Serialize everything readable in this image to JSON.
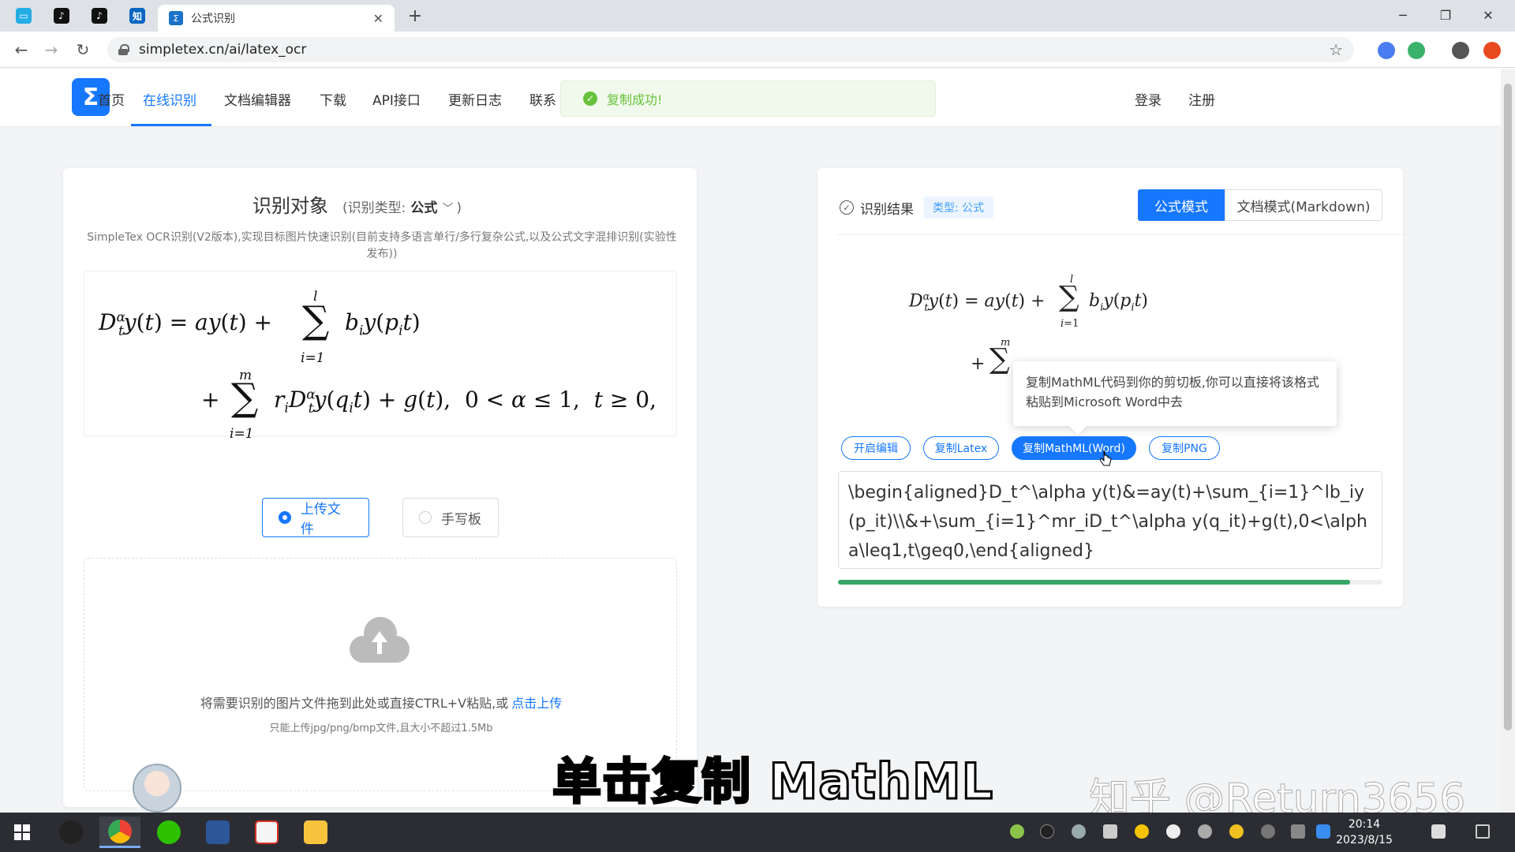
{
  "browser": {
    "active_tab_title": "公式识别",
    "tab_close": "✕",
    "new_tab": "+",
    "url": "simpletex.cn/ai/latex_ocr",
    "minimize": "─",
    "maximize": "❐",
    "close": "✕"
  },
  "site": {
    "nav": [
      "首页",
      "在线识别",
      "文档编辑器",
      "下载",
      "API接口",
      "更新日志",
      "联系"
    ],
    "login": "登录",
    "register": "注册",
    "toast": "复制成功!"
  },
  "left": {
    "title": "识别对象",
    "type_label": "(识别类型:",
    "type_value": "公式",
    "type_close": ")",
    "description": "SimpleTex OCR识别(V2版本),实现目标图片快速识别(目前支持多语言单行/多行复杂公式,以及公式文字混排识别(实验性发布))",
    "mode_upload": "上传文件",
    "mode_handwrite": "手写板",
    "drop_text": "将需要识别的图片文件拖到此处或直接CTRL+V粘贴,或",
    "drop_link": "点击上传",
    "drop_hint": "只能上传jpg/png/bmp文件,且大小不超过1.5Mb"
  },
  "right": {
    "result_label": "识别结果",
    "type_badge": "类型: 公式",
    "mode_formula": "公式模式",
    "mode_doc": "文档模式(Markdown)",
    "tooltip": "复制MathML代码到你的剪切板,你可以直接将该格式粘贴到Microsoft Word中去",
    "btn_edit": "开启编辑",
    "btn_latex": "复制Latex",
    "btn_mathml": "复制MathML(Word)",
    "btn_png": "复制PNG",
    "latex": "\\begin{aligned}D_t^\\alpha y(t)&=ay(t)+\\sum_{i=1}^lb_iy(p_it)\\\\&+\\sum_{i=1}^mr_iD_t^\\alpha y(q_it)+g(t),0<\\alpha\\leq1,t\\geq0,\\end{aligned}",
    "progress": 0.94
  },
  "overlay": {
    "subtitle": "单击复制 MathML",
    "watermark": "知乎 @Return3656"
  },
  "taskbar": {
    "time": "20:14",
    "date": "2023/8/15"
  },
  "colors": {
    "accent": "#1677ff",
    "success": "#67c23a",
    "progress": "#3aa767"
  }
}
